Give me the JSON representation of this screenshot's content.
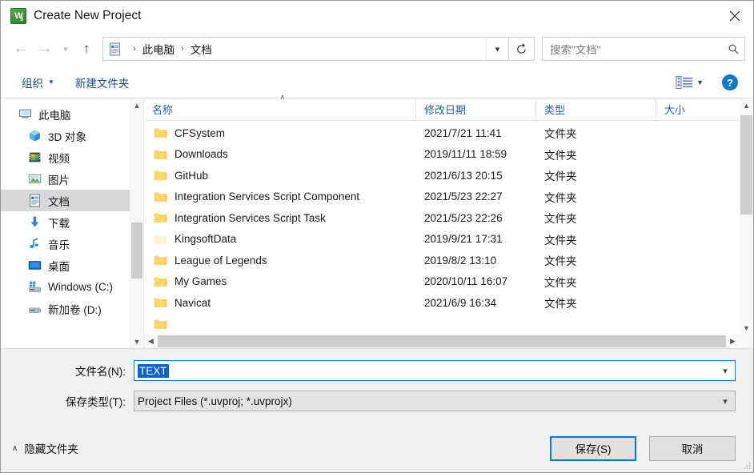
{
  "window": {
    "title": "Create New Project",
    "app_icon": "uvision-icon",
    "close_label": "✕"
  },
  "nav": {
    "back_icon": "arrow-left-icon",
    "forward_icon": "arrow-right-icon",
    "recent_icon": "chevron-down-icon",
    "up_icon": "arrow-up-icon",
    "breadcrumb_icon": "documents-icon",
    "breadcrumb": [
      "此电脑",
      "文档"
    ],
    "separator": "›",
    "dropdown_icon": "chevron-down-icon",
    "refresh_icon": "refresh-icon"
  },
  "search": {
    "placeholder": "搜索\"文档\"",
    "icon": "search-icon"
  },
  "toolbar": {
    "organize_label": "组织",
    "organize_caret": "▼",
    "new_folder_label": "新建文件夹",
    "view_icon": "view-list-icon",
    "view_caret": "▼",
    "help_icon": "help-icon"
  },
  "sidebar": {
    "items": [
      {
        "label": "此电脑",
        "icon": "computer-icon",
        "level": 1,
        "selected": false
      },
      {
        "label": "3D 对象",
        "icon": "3d-objects-icon",
        "level": 2,
        "selected": false
      },
      {
        "label": "视频",
        "icon": "videos-icon",
        "level": 2,
        "selected": false
      },
      {
        "label": "图片",
        "icon": "pictures-icon",
        "level": 2,
        "selected": false
      },
      {
        "label": "文档",
        "icon": "documents-icon",
        "level": 2,
        "selected": true
      },
      {
        "label": "下载",
        "icon": "downloads-icon",
        "level": 2,
        "selected": false
      },
      {
        "label": "音乐",
        "icon": "music-icon",
        "level": 2,
        "selected": false
      },
      {
        "label": "桌面",
        "icon": "desktop-icon",
        "level": 2,
        "selected": false
      },
      {
        "label": "Windows (C:)",
        "icon": "windows-drive-icon",
        "level": 2,
        "selected": false
      },
      {
        "label": "新加卷 (D:)",
        "icon": "drive-icon",
        "level": 2,
        "selected": false
      }
    ],
    "scroll_up_icon": "chevron-up-icon",
    "scroll_down_icon": "chevron-down-icon"
  },
  "filelist": {
    "columns": [
      "名称",
      "修改日期",
      "类型",
      "大小"
    ],
    "sort_column": "名称",
    "sort_caret": "∧",
    "rows": [
      {
        "name": "CFSystem",
        "date": "2021/7/21 11:41",
        "type": "文件夹",
        "size": "",
        "hidden": false
      },
      {
        "name": "Downloads",
        "date": "2019/11/11 18:59",
        "type": "文件夹",
        "size": "",
        "hidden": false
      },
      {
        "name": "GitHub",
        "date": "2021/6/13 20:15",
        "type": "文件夹",
        "size": "",
        "hidden": false
      },
      {
        "name": "Integration Services Script Component",
        "date": "2021/5/23 22:27",
        "type": "文件夹",
        "size": "",
        "hidden": false
      },
      {
        "name": "Integration Services Script Task",
        "date": "2021/5/23 22:26",
        "type": "文件夹",
        "size": "",
        "hidden": false
      },
      {
        "name": "KingsoftData",
        "date": "2019/9/21 17:31",
        "type": "文件夹",
        "size": "",
        "hidden": true
      },
      {
        "name": "League of Legends",
        "date": "2019/8/2 13:10",
        "type": "文件夹",
        "size": "",
        "hidden": false
      },
      {
        "name": "My Games",
        "date": "2020/10/11 16:07",
        "type": "文件夹",
        "size": "",
        "hidden": false
      },
      {
        "name": "Navicat",
        "date": "2021/6/9 16:34",
        "type": "文件夹",
        "size": "",
        "hidden": false
      }
    ],
    "vscroll_up_icon": "chevron-up-icon",
    "vscroll_down_icon": "chevron-down-icon",
    "hscroll_left_icon": "chevron-left-icon",
    "hscroll_right_icon": "chevron-right-icon"
  },
  "form": {
    "filename_label": "文件名(N):",
    "filename_value": "TEXT",
    "filetype_label": "保存类型(T):",
    "filetype_value": "Project Files (*.uvproj; *.uvprojx)",
    "dropdown_icon": "chevron-down-icon"
  },
  "footer": {
    "hide_folders_label": "隐藏文件夹",
    "hide_folders_caret": "∧",
    "save_label": "保存(S)",
    "cancel_label": "取消"
  },
  "colors": {
    "accent": "#0078d7",
    "link": "#1d4e86",
    "header_link": "#25619c",
    "selection": "#0a63c9",
    "selected_row": "#d8d8d8",
    "folder": "#fbd66d",
    "dialog_bg": "#f0f0f0"
  }
}
